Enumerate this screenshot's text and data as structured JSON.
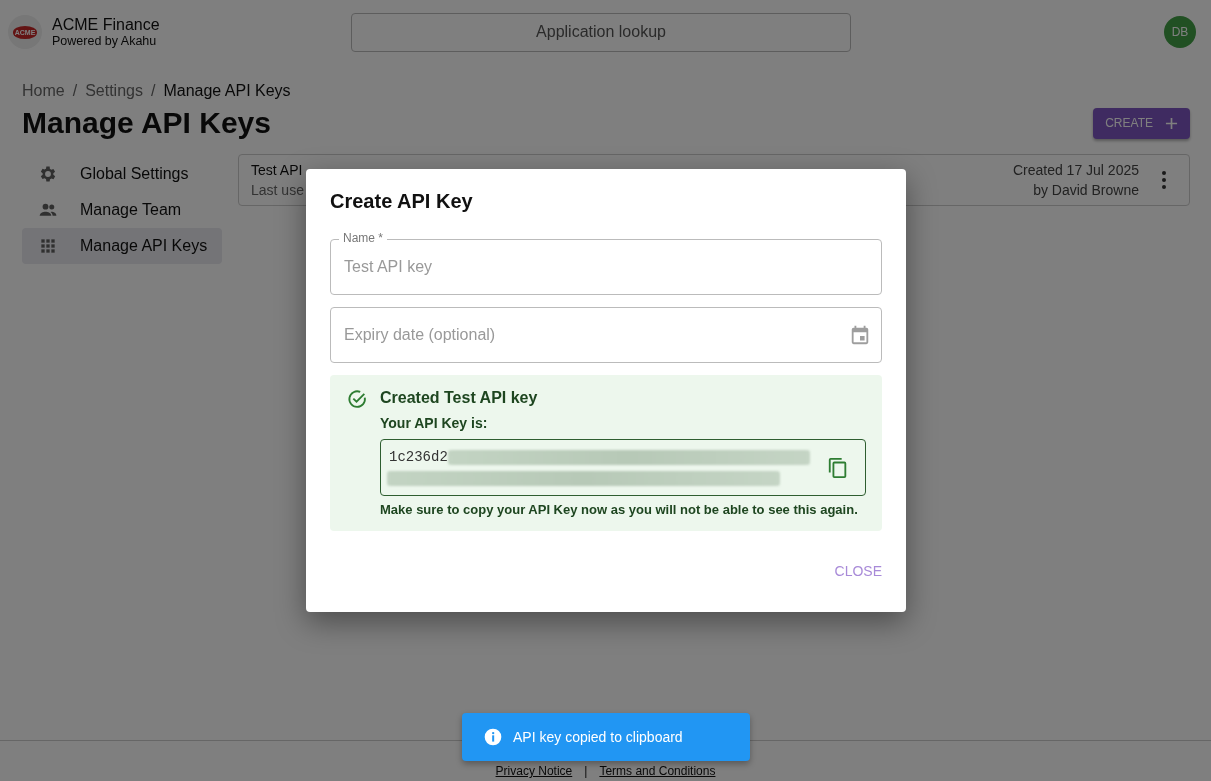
{
  "header": {
    "logo_text": "ACME",
    "brand": "ACME Finance",
    "tagline": "Powered by Akahu",
    "search": {
      "placeholder": "Application lookup"
    },
    "avatar": "DB"
  },
  "breadcrumb": [
    {
      "label": "Home",
      "current": false
    },
    {
      "label": "Settings",
      "current": false
    },
    {
      "label": "Manage API Keys",
      "current": true
    }
  ],
  "breadcrumb_separator": "/",
  "page_title": "Manage API Keys",
  "create_button": "CREATE",
  "sidebar": {
    "items": [
      {
        "label": "Global Settings",
        "kind": "gear",
        "selected": false
      },
      {
        "label": "Manage Team",
        "kind": "people",
        "selected": false
      },
      {
        "label": "Manage API Keys",
        "kind": "grid",
        "selected": true
      }
    ]
  },
  "api_keys": [
    {
      "name": "Test API",
      "last_used": "Last use",
      "created": "Created 17 Jul 2025",
      "created_by": "by David Browne"
    }
  ],
  "dialog": {
    "title": "Create API Key",
    "name_field": {
      "label": "Name *",
      "placeholder": "Test API key"
    },
    "expiry_field": {
      "placeholder": "Expiry date (optional)"
    },
    "alert": {
      "title": "Created Test API key",
      "label": "Your API Key is:",
      "key_visible": "1c236d2",
      "warning": "Make sure to copy your API Key now as you will not be able to see this again."
    },
    "close_button": "CLOSE"
  },
  "footer": {
    "links": [
      "Privacy Notice",
      "Terms and Conditions"
    ],
    "separator": "|"
  },
  "toast": {
    "message": "API key copied to clipboard"
  }
}
